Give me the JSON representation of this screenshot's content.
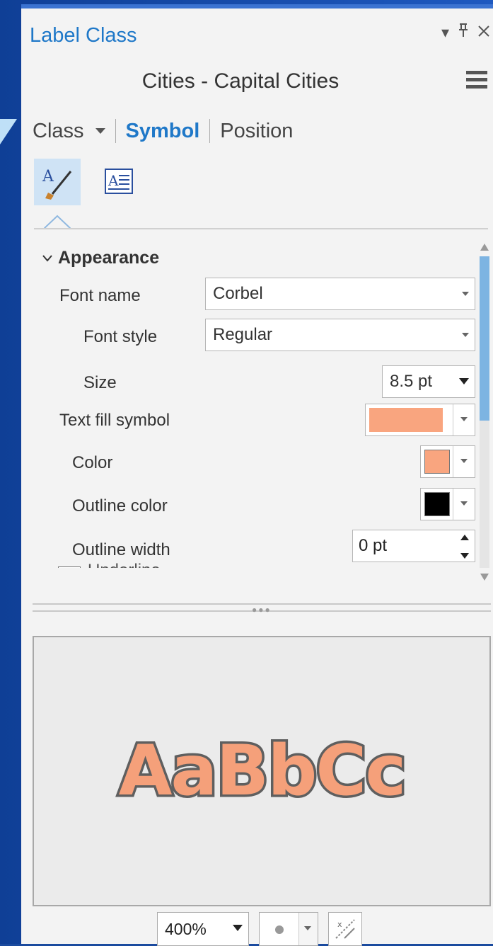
{
  "pane": {
    "title": "Label Class",
    "subtitle": "Cities - Capital Cities"
  },
  "tabs": {
    "class": "Class",
    "symbol": "Symbol",
    "position": "Position"
  },
  "appearance": {
    "header": "Appearance",
    "font_name_label": "Font name",
    "font_name_value": "Corbel",
    "font_style_label": "Font style",
    "font_style_value": "Regular",
    "size_label": "Size",
    "size_value": "8.5 pt",
    "text_fill_label": "Text fill symbol",
    "color_label": "Color",
    "outline_color_label": "Outline color",
    "outline_width_label": "Outline width",
    "outline_width_value": "0 pt",
    "next_label": "Underline"
  },
  "colors": {
    "fill": "#f9a57f",
    "outline": "#000000",
    "accent": "#1f78c8",
    "preview_outline": "#5f5f5f"
  },
  "preview": {
    "sample_text": "AaBbCc"
  },
  "bottom": {
    "zoom_value": "400%"
  }
}
